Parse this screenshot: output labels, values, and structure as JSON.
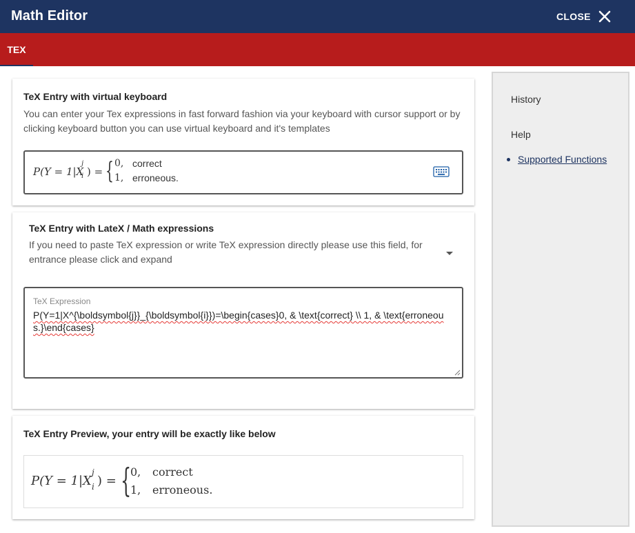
{
  "window": {
    "title": "Math Editor",
    "close_label": "CLOSE",
    "close_icon": "close-icon"
  },
  "tabs": [
    {
      "label": "TEX",
      "active": true
    }
  ],
  "virtual_keyboard_section": {
    "title": "TeX Entry with virtual keyboard",
    "description": "You can enter your Tex expressions in fast forward fashion via your keyboard with cursor support or by clicking keyboard button you can use virtual keyboard and it's templates",
    "keyboard_icon": "keyboard-icon"
  },
  "formula": {
    "lhs": "P(Y = 1|X",
    "sup": "j",
    "sub": "i",
    "rhs": ") =",
    "cases": [
      {
        "value": "0,",
        "label": "correct"
      },
      {
        "value": "1,",
        "label": "erroneous."
      }
    ]
  },
  "latex_section": {
    "title": "TeX Entry with LateX / Math expressions",
    "description": "If you need to paste TeX expression or write TeX expression directly please use this field, for entrance please click and expand",
    "field_label": "TeX Expression",
    "field_value": "P(Y=1|X^{\\boldsymbol{j}}_{\\boldsymbol{i}})=\\begin{cases}0, & \\text{correct} \\\\ 1, & \\text{erroneous.}\\end{cases}"
  },
  "preview_section": {
    "title": "TeX Entry Preview, your entry will be exactly like below"
  },
  "sidebar": {
    "history_label": "History",
    "help_label": "Help",
    "link_label": "Supported Functions"
  },
  "colors": {
    "titlebar": "#1e3461",
    "tabbar": "#b71c1c",
    "sidebar": "#eeeeee"
  }
}
